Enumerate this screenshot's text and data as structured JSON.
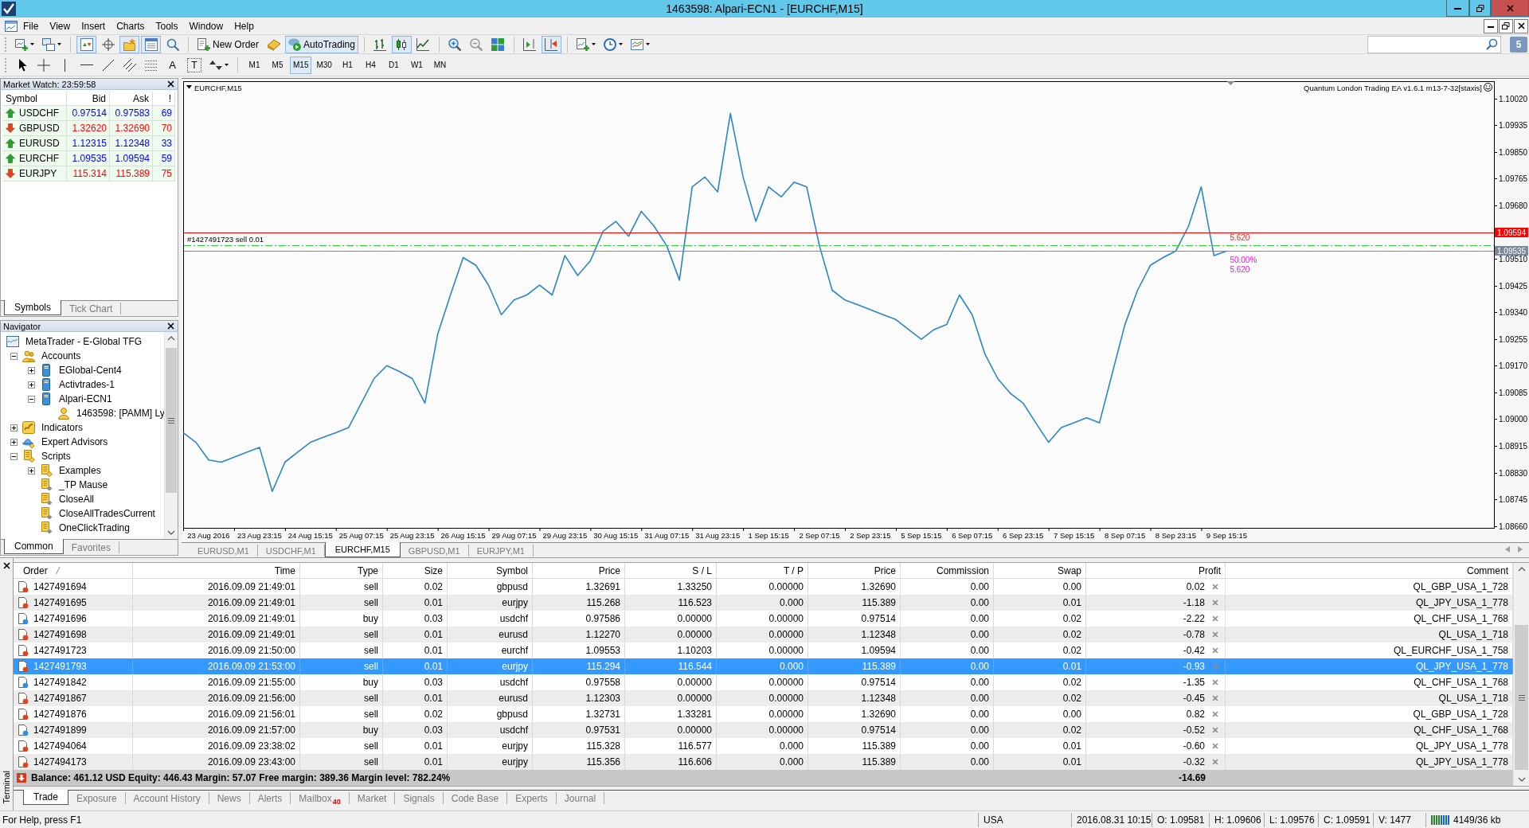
{
  "window": {
    "title": "1463598: Alpari-ECN1 - [EURCHF,M15]"
  },
  "menu": [
    "File",
    "View",
    "Insert",
    "Charts",
    "Tools",
    "Window",
    "Help"
  ],
  "toolbar": {
    "window_toggles": [
      {
        "on": true
      },
      {
        "on": false
      },
      {
        "on": true
      },
      {
        "on": true
      },
      {
        "on": false
      }
    ],
    "new_order": "New Order",
    "auto_trading": {
      "label": "AutoTrading",
      "on": true
    },
    "chart_types": [
      {
        "selected": false
      },
      {
        "selected": true
      },
      {
        "selected": false
      }
    ],
    "chart_shift": {
      "on": false
    },
    "auto_scroll": {
      "on": true
    },
    "notifications": "5"
  },
  "drawing_toolbar": {
    "text_tool": "A",
    "label_tool": "T",
    "periods": [
      {
        "label": "M1",
        "selected": false
      },
      {
        "label": "M5",
        "selected": false
      },
      {
        "label": "M15",
        "selected": true
      },
      {
        "label": "M30",
        "selected": false
      },
      {
        "label": "H1",
        "selected": false
      },
      {
        "label": "H4",
        "selected": false
      },
      {
        "label": "D1",
        "selected": false
      },
      {
        "label": "W1",
        "selected": false
      },
      {
        "label": "MN",
        "selected": false
      }
    ]
  },
  "market_watch": {
    "title": "Market Watch: 23:59:58",
    "columns": [
      "Symbol",
      "Bid",
      "Ask",
      "!"
    ],
    "rows": [
      {
        "symbol": "USDCHF",
        "bid": "0.97514",
        "ask": "0.97583",
        "spread": "69",
        "kind": "up"
      },
      {
        "symbol": "GBPUSD",
        "bid": "1.32620",
        "ask": "1.32690",
        "spread": "70",
        "kind": "down"
      },
      {
        "symbol": "EURUSD",
        "bid": "1.12315",
        "ask": "1.12348",
        "spread": "33",
        "kind": "up"
      },
      {
        "symbol": "EURCHF",
        "bid": "1.09535",
        "ask": "1.09594",
        "spread": "59",
        "kind": "up"
      },
      {
        "symbol": "EURJPY",
        "bid": "115.314",
        "ask": "115.389",
        "spread": "75",
        "kind": "down"
      }
    ],
    "tabs": [
      {
        "label": "Symbols",
        "selected": true
      },
      {
        "label": "Tick Chart",
        "selected": false
      }
    ]
  },
  "navigator": {
    "title": "Navigator",
    "tree": [
      {
        "label": "MetaTrader - E-Global TFG",
        "kind": "platform",
        "children": [
          {
            "label": "Accounts",
            "kind": "accounts",
            "expanded": true,
            "children": [
              {
                "label": "EGlobal-Cent4",
                "kind": "server",
                "expanded": false
              },
              {
                "label": "Activtrades-1",
                "kind": "server",
                "expanded": false
              },
              {
                "label": "Alpari-ECN1",
                "kind": "server",
                "expanded": true,
                "children": [
                  {
                    "label": "1463598: [PAMM] Ly",
                    "kind": "account"
                  }
                ]
              }
            ]
          },
          {
            "label": "Indicators",
            "kind": "indicators",
            "expanded": false
          },
          {
            "label": "Expert Advisors",
            "kind": "experts",
            "expanded": false
          },
          {
            "label": "Scripts",
            "kind": "scripts",
            "expanded": true,
            "children": [
              {
                "label": "Examples",
                "kind": "scripts",
                "expanded": false
              },
              {
                "label": "_TP Mause",
                "kind": "script"
              },
              {
                "label": "CloseAll",
                "kind": "script"
              },
              {
                "label": "CloseAllTradesCurrent",
                "kind": "script"
              },
              {
                "label": "OneClickTrading",
                "kind": "script"
              }
            ]
          }
        ]
      }
    ],
    "tabs": [
      {
        "label": "Common",
        "selected": true
      },
      {
        "label": "Favorites",
        "selected": false
      }
    ]
  },
  "chart": {
    "expert_advisor": "Quantum London Trading EA v1.6.1 m13-7-32[staxis]",
    "chart_data": [
      {
        "type": "line",
        "title": "EURCHF,M15",
        "categories": [
          null,
          null,
          "23 Aug 2016",
          null,
          null,
          null,
          "23 Aug 23:15",
          null,
          null,
          null,
          "24 Aug 15:15",
          null,
          null,
          null,
          "25 Aug 07:15",
          null,
          null,
          null,
          "25 Aug 23:15",
          null,
          null,
          null,
          "26 Aug 15:15",
          null,
          null,
          null,
          "29 Aug 07:15",
          null,
          null,
          null,
          "29 Aug 23:15",
          null,
          null,
          null,
          "30 Aug 15:15",
          null,
          null,
          null,
          "31 Aug 07:15",
          null,
          null,
          null,
          "31 Aug 23:15",
          null,
          null,
          null,
          "1 Sep 15:15",
          null,
          null,
          null,
          "2 Sep 07:15",
          null,
          null,
          null,
          "2 Sep 23:15",
          null,
          null,
          null,
          "5 Sep 15:15",
          null,
          null,
          null,
          "6 Sep 07:15",
          null,
          null,
          null,
          "6 Sep 23:15",
          null,
          null,
          null,
          "7 Sep 15:15",
          null,
          null,
          null,
          "8 Sep 07:15",
          null,
          null,
          null,
          "8 Sep 23:15",
          null,
          null,
          null,
          "9 Sep 15:15",
          null,
          null,
          null,
          null,
          null,
          null,
          null,
          null,
          null,
          null,
          null,
          null,
          null,
          null,
          null,
          null,
          null,
          null,
          null,
          null,
          null
        ],
        "values": [
          1.08957,
          1.08926,
          1.0887,
          1.08863,
          1.08879,
          1.08895,
          1.0891,
          1.0877,
          1.08863,
          1.08895,
          1.08926,
          1.08942,
          1.08957,
          1.08973,
          1.09051,
          1.09129,
          1.0917,
          1.09151,
          1.09129,
          1.09051,
          1.0927,
          1.09395,
          1.09514,
          1.09489,
          1.09426,
          1.09332,
          1.09379,
          1.09395,
          1.09426,
          1.09395,
          1.0952,
          1.09457,
          1.09504,
          1.09598,
          1.09629,
          1.09582,
          1.09661,
          1.09614,
          1.09551,
          1.09442,
          1.09739,
          1.0977,
          1.09723,
          1.09973,
          1.0977,
          1.09629,
          1.09739,
          1.09707,
          1.09754,
          1.09739,
          1.09551,
          1.0941,
          1.09379,
          1.09364,
          1.09348,
          1.09332,
          1.09317,
          1.09285,
          1.09254,
          1.09285,
          1.09301,
          1.09395,
          1.09332,
          1.09207,
          1.09129,
          1.09082,
          1.09051,
          1.08988,
          1.08926,
          1.08973,
          1.08988,
          1.09004,
          1.08988,
          1.09145,
          1.09301,
          1.0941,
          1.09489,
          1.09514,
          1.09535,
          1.09614,
          1.09739,
          1.0952,
          1.09535,
          null,
          null,
          null,
          null,
          null,
          null,
          null,
          null,
          null,
          null,
          null,
          null,
          null,
          null,
          null,
          null,
          null,
          null,
          null,
          null,
          null
        ],
        "color": "#2a86c4",
        "ylim": [
          1.08654,
          1.10075
        ],
        "yticks": [
          {
            "value": 1.1002,
            "label": "1.10020"
          },
          {
            "value": 1.09935,
            "label": "1.09935"
          },
          {
            "value": 1.0985,
            "label": "1.09850"
          },
          {
            "value": 1.09765,
            "label": "1.09765"
          },
          {
            "value": 1.0968,
            "label": "1.09680"
          },
          {
            "value": 1.0951,
            "label": "1.09510"
          },
          {
            "value": 1.09425,
            "label": "1.09425"
          },
          {
            "value": 1.0934,
            "label": "1.09340"
          },
          {
            "value": 1.09255,
            "label": "1.09255"
          },
          {
            "value": 1.0917,
            "label": "1.09170"
          },
          {
            "value": 1.09085,
            "label": "1.09085"
          },
          {
            "value": 1.09,
            "label": "1.09000"
          },
          {
            "value": 1.08915,
            "label": "1.08915"
          },
          {
            "value": 1.0883,
            "label": "1.08830"
          },
          {
            "value": 1.08745,
            "label": "1.08745"
          },
          {
            "value": 1.0866,
            "label": "1.08660"
          }
        ],
        "ref_lines": [
          {
            "axis": "y",
            "value": 1.09594,
            "label": "1.09594",
            "color": "#ff0000",
            "line_style": "solid"
          },
          {
            "axis": "y",
            "value": 1.09553,
            "label": "#1427491723 sell 0.01",
            "color": "#32cd32",
            "line_style": "dashdot"
          },
          {
            "axis": "y",
            "value": 1.09535,
            "label": "1.09535",
            "color": "#7a8899",
            "line_style": "solid"
          }
        ],
        "annotations": [
          "5.620",
          "50.00%",
          "5.620"
        ]
      }
    ],
    "tabs": [
      {
        "label": "EURUSD,M1",
        "selected": false
      },
      {
        "label": "USDCHF,M1",
        "selected": false
      },
      {
        "label": "EURCHF,M15",
        "selected": true
      },
      {
        "label": "GBPUSD,M1",
        "selected": false
      },
      {
        "label": "EURJPY,M1",
        "selected": false
      }
    ]
  },
  "terminal": {
    "title": "Terminal",
    "columns": [
      "Order",
      "Time",
      "Type",
      "Size",
      "Symbol",
      "Price",
      "S / L",
      "T / P",
      "Price",
      "Commission",
      "Swap",
      "Profit",
      "Comment"
    ],
    "rows": [
      {
        "kind": "sell",
        "selected": false,
        "cells": [
          "1427491694",
          "2016.09.09 21:49:01",
          "sell",
          "0.02",
          "gbpusd",
          "1.32691",
          "1.33250",
          "0.00000",
          "1.32690",
          "0.00",
          "0.00",
          "0.02",
          "QL_GBP_USA_1_728"
        ]
      },
      {
        "kind": "sell",
        "selected": false,
        "cells": [
          "1427491695",
          "2016.09.09 21:49:01",
          "sell",
          "0.01",
          "eurjpy",
          "115.268",
          "116.523",
          "0.000",
          "115.389",
          "0.00",
          "0.01",
          "-1.18",
          "QL_JPY_USA_1_778"
        ]
      },
      {
        "kind": "buy",
        "selected": false,
        "cells": [
          "1427491696",
          "2016.09.09 21:49:01",
          "buy",
          "0.03",
          "usdchf",
          "0.97586",
          "0.00000",
          "0.00000",
          "0.97514",
          "0.00",
          "0.02",
          "-2.22",
          "QL_CHF_USA_1_768"
        ]
      },
      {
        "kind": "sell",
        "selected": false,
        "cells": [
          "1427491698",
          "2016.09.09 21:49:01",
          "sell",
          "0.01",
          "eurusd",
          "1.12270",
          "0.00000",
          "0.00000",
          "1.12348",
          "0.00",
          "0.02",
          "-0.78",
          "QL_USA_1_718"
        ]
      },
      {
        "kind": "sell",
        "selected": false,
        "cells": [
          "1427491723",
          "2016.09.09 21:50:00",
          "sell",
          "0.01",
          "eurchf",
          "1.09553",
          "1.10203",
          "0.00000",
          "1.09594",
          "0.00",
          "0.02",
          "-0.42",
          "QL_EURCHF_USA_1_758"
        ]
      },
      {
        "kind": "sell",
        "selected": true,
        "cells": [
          "1427491793",
          "2016.09.09 21:53:00",
          "sell",
          "0.01",
          "eurjpy",
          "115.294",
          "116.544",
          "0.000",
          "115.389",
          "0.00",
          "0.01",
          "-0.93",
          "QL_JPY_USA_1_778"
        ]
      },
      {
        "kind": "buy",
        "selected": false,
        "cells": [
          "1427491842",
          "2016.09.09 21:55:00",
          "buy",
          "0.03",
          "usdchf",
          "0.97558",
          "0.00000",
          "0.00000",
          "0.97514",
          "0.00",
          "0.02",
          "-1.35",
          "QL_CHF_USA_1_768"
        ]
      },
      {
        "kind": "sell",
        "selected": false,
        "cells": [
          "1427491867",
          "2016.09.09 21:56:00",
          "sell",
          "0.01",
          "eurusd",
          "1.12303",
          "0.00000",
          "0.00000",
          "1.12348",
          "0.00",
          "0.02",
          "-0.45",
          "QL_USA_1_718"
        ]
      },
      {
        "kind": "sell",
        "selected": false,
        "cells": [
          "1427491876",
          "2016.09.09 21:56:01",
          "sell",
          "0.02",
          "gbpusd",
          "1.32731",
          "1.33281",
          "0.00000",
          "1.32690",
          "0.00",
          "0.00",
          "0.82",
          "QL_GBP_USA_1_728"
        ]
      },
      {
        "kind": "buy",
        "selected": false,
        "cells": [
          "1427491899",
          "2016.09.09 21:57:00",
          "buy",
          "0.03",
          "usdchf",
          "0.97531",
          "0.00000",
          "0.00000",
          "0.97514",
          "0.00",
          "0.02",
          "-0.52",
          "QL_CHF_USA_1_768"
        ]
      },
      {
        "kind": "sell",
        "selected": false,
        "cells": [
          "1427494064",
          "2016.09.09 23:38:02",
          "sell",
          "0.01",
          "eurjpy",
          "115.328",
          "116.577",
          "0.000",
          "115.389",
          "0.00",
          "0.01",
          "-0.60",
          "QL_JPY_USA_1_778"
        ]
      },
      {
        "kind": "sell",
        "selected": false,
        "cells": [
          "1427494173",
          "2016.09.09 23:43:00",
          "sell",
          "0.01",
          "eurjpy",
          "115.356",
          "116.606",
          "0.000",
          "115.389",
          "0.00",
          "0.01",
          "-0.32",
          "QL_JPY_USA_1_778"
        ]
      }
    ],
    "summary": {
      "text": "Balance: 461.12 USD Equity: 446.43 Margin: 57.07 Free margin: 389.36 Margin level: 782.24%",
      "profit": "-14.69"
    },
    "tabs": [
      {
        "label": "Trade",
        "selected": true
      },
      {
        "label": "Exposure",
        "selected": false
      },
      {
        "label": "Account History",
        "selected": false
      },
      {
        "label": "News",
        "selected": false
      },
      {
        "label": "Alerts",
        "selected": false
      },
      {
        "label": "Mailbox",
        "badge": "40",
        "selected": false
      },
      {
        "label": "Market",
        "selected": false
      },
      {
        "label": "Signals",
        "selected": false
      },
      {
        "label": "Code Base",
        "selected": false
      },
      {
        "label": "Experts",
        "selected": false
      },
      {
        "label": "Journal",
        "selected": false
      }
    ]
  },
  "status_bar": {
    "help": "For Help, press F1",
    "profile": "USA",
    "time": "2016.08.31 10:15",
    "open": "O: 1.09581",
    "high": "H: 1.09606",
    "low": "L: 1.09576",
    "close": "C: 1.09591",
    "volume": "V: 1477",
    "traffic": "4149/36 kb"
  }
}
